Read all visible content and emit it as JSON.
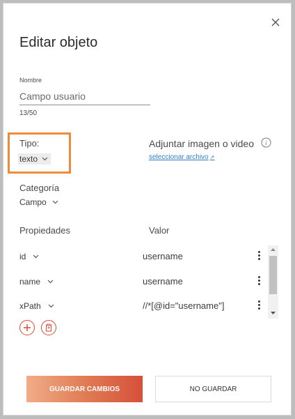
{
  "dialog": {
    "title": "Editar objeto",
    "close_icon": "close-icon"
  },
  "name_field": {
    "label": "Nombre",
    "value": "Campo usuario",
    "char_count": "13/50"
  },
  "tipo": {
    "label": "Tipo:",
    "selected": "texto",
    "highlight_color": "#f08a3b"
  },
  "attachment": {
    "label": "Adjuntar imagen o video",
    "link": "seleccionar archivo",
    "link_icon": "external-arrow-icon",
    "info_icon": "info-icon"
  },
  "categoria": {
    "label": "Categoría",
    "selected": "Campo"
  },
  "properties": {
    "header_prop": "Propiedades",
    "header_value": "Valor",
    "rows": [
      {
        "name": "id",
        "value": "username"
      },
      {
        "name": "name",
        "value": "username"
      },
      {
        "name": "xPath",
        "value": "//*[@id=\"username\"]"
      }
    ],
    "add_icon": "plus-circle-icon",
    "clipboard_icon": "clipboard-circle-icon"
  },
  "buttons": {
    "save": "GUARDAR CAMBIOS",
    "discard": "NO GUARDAR"
  },
  "colors": {
    "accent": "#d84a35",
    "link": "#2f80c9"
  }
}
